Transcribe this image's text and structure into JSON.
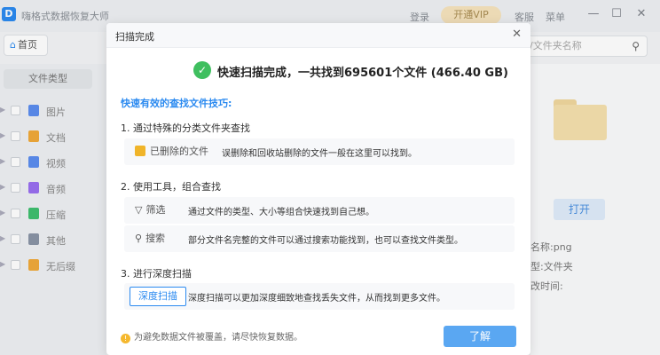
{
  "app": {
    "logo_letter": "D",
    "title": "嗨格式数据恢复大师",
    "login": "登录",
    "vip": "开通VIP",
    "service": "客服",
    "menu": "菜单"
  },
  "toolbar": {
    "home": "首页",
    "search_placeholder": "/文件夹名称"
  },
  "sidebar": {
    "tab": "文件类型",
    "items": [
      {
        "label": "图片",
        "icon": "image-icon",
        "color": "#5b8def"
      },
      {
        "label": "文档",
        "icon": "document-icon",
        "color": "#f0a93a"
      },
      {
        "label": "视频",
        "icon": "video-icon",
        "color": "#5b8def"
      },
      {
        "label": "音频",
        "icon": "audio-icon",
        "color": "#9a6ff0"
      },
      {
        "label": "压缩",
        "icon": "archive-icon",
        "color": "#3fbf6f"
      },
      {
        "label": "其他",
        "icon": "other-file-icon",
        "color": "#8a94a6"
      },
      {
        "label": "无后缀",
        "icon": "no-extension-icon",
        "color": "#f0a93a"
      }
    ]
  },
  "right_panel": {
    "open": "打开",
    "meta": [
      "名称:png",
      "型:文件夹",
      "改时间:"
    ]
  },
  "dialog": {
    "title": "扫描完成",
    "result": "快速扫描完成，一共找到695601个文件 (466.40 GB)",
    "tips_title": "快速有效的查找文件技巧:",
    "sections": [
      {
        "title": "1. 通过特殊的分类文件夹查找"
      },
      {
        "title": "2. 使用工具，组合查找"
      },
      {
        "title": "3. 进行深度扫描"
      }
    ],
    "rows": {
      "deleted": {
        "label": "已删除的文件",
        "desc": "误删除和回收站删除的文件一般在这里可以找到。"
      },
      "filter": {
        "label": "筛选",
        "desc": "通过文件的类型、大小等组合快速找到自己想。"
      },
      "search": {
        "label": "搜索",
        "desc": "部分文件名完整的文件可以通过搜索功能找到，也可以查找文件类型。"
      },
      "deep": {
        "label": "深度扫描",
        "desc": "深度扫描可以更加深度细致地查找丢失文件，从而找到更多文件。"
      }
    },
    "warning": "为避免数据文件被覆盖，请尽快恢复数据。",
    "ok": "了解"
  }
}
